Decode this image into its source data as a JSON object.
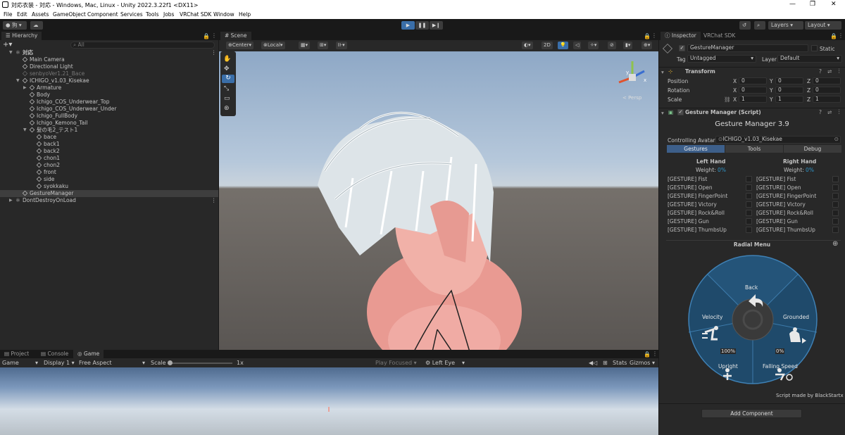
{
  "window": {
    "title": "対応衣装 - 対応 - Windows, Mac, Linux - Unity 2022.3.22f1 <DX11>"
  },
  "menu": [
    "File",
    "Edit",
    "Assets",
    "GameObject",
    "Component",
    "Services",
    "Tools",
    "Jobs",
    "VRChat SDK",
    "Window",
    "Help"
  ],
  "toolbar": {
    "account": "狗",
    "layers": "Layers",
    "layout": "Layout"
  },
  "hierarchy": {
    "tab": "Hierarchy",
    "search_placeholder": "All",
    "items": [
      {
        "label": "対応",
        "depth": 0,
        "kind": "scene"
      },
      {
        "label": "Main Camera",
        "depth": 1,
        "kind": "object"
      },
      {
        "label": "Directional Light",
        "depth": 1,
        "kind": "object"
      },
      {
        "label": "senbyoVer1.21_Bace",
        "depth": 1,
        "kind": "disabled"
      },
      {
        "label": "ICHIGO_v1.03_Kisekae",
        "depth": 1,
        "kind": "object"
      },
      {
        "label": "Armature",
        "depth": 2,
        "kind": "object"
      },
      {
        "label": "Body",
        "depth": 2,
        "kind": "object"
      },
      {
        "label": "Ichigo_COS_Underwear_Top",
        "depth": 2,
        "kind": "object"
      },
      {
        "label": "Ichigo_COS_Underwear_Under",
        "depth": 2,
        "kind": "object"
      },
      {
        "label": "Ichigo_FullBody",
        "depth": 2,
        "kind": "object"
      },
      {
        "label": "Ichigo_Kemono_Tail",
        "depth": 2,
        "kind": "object"
      },
      {
        "label": "髪の毛2_テスト1",
        "depth": 2,
        "kind": "object"
      },
      {
        "label": "bace",
        "depth": 3,
        "kind": "object"
      },
      {
        "label": "back1",
        "depth": 3,
        "kind": "object"
      },
      {
        "label": "back2",
        "depth": 3,
        "kind": "object"
      },
      {
        "label": "chon1",
        "depth": 3,
        "kind": "object"
      },
      {
        "label": "chon2",
        "depth": 3,
        "kind": "object"
      },
      {
        "label": "front",
        "depth": 3,
        "kind": "object"
      },
      {
        "label": "side",
        "depth": 3,
        "kind": "object"
      },
      {
        "label": "syokkaku",
        "depth": 3,
        "kind": "object"
      },
      {
        "label": "GestureManager",
        "depth": 1,
        "kind": "selected"
      },
      {
        "label": "DontDestroyOnLoad",
        "depth": 0,
        "kind": "scene"
      }
    ]
  },
  "scene": {
    "tab": "Scene",
    "pivot": "Center",
    "space": "Local",
    "mode2d": "2D",
    "persp": "< Persp"
  },
  "bottom_tabs": {
    "project": "Project",
    "console": "Console",
    "game": "Game"
  },
  "game": {
    "display_mode": "Game",
    "display": "Display 1",
    "aspect": "Free Aspect",
    "scale_label": "Scale",
    "scale_value": "1x",
    "play_focused": "Play Focused",
    "eye": "Left Eye",
    "stats": "Stats",
    "gizmos": "Gizmos"
  },
  "inspector": {
    "tab": "Inspector",
    "tab2": "VRChat SDK",
    "object_name": "GestureManager",
    "static": "Static",
    "tag_label": "Tag",
    "tag_value": "Untagged",
    "layer_label": "Layer",
    "layer_value": "Default",
    "transform": {
      "title": "Transform",
      "position_label": "Position",
      "rotation_label": "Rotation",
      "scale_label": "Scale",
      "position": [
        "0",
        "0",
        "0"
      ],
      "rotation": [
        "0",
        "0",
        "0"
      ],
      "scale": [
        "1",
        "1",
        "1"
      ],
      "x": "X",
      "y": "Y",
      "z": "Z"
    },
    "script": {
      "title": "Gesture Manager (Script)",
      "heading": "Gesture Manager 3.9",
      "controlling_label": "Controlling Avatar:",
      "controlling_value": "ICHIGO_v1.03_Kisekae",
      "tabs": [
        "Gestures",
        "Tools",
        "Debug"
      ],
      "left_hand": "Left Hand",
      "right_hand": "Right Hand",
      "weight_label": "Weight:",
      "weight_value": "0%",
      "gestures": [
        "[GESTURE] Fist",
        "[GESTURE] Open",
        "[GESTURE] FingerPoint",
        "[GESTURE] Victory",
        "[GESTURE] Rock&Roll",
        "[GESTURE] Gun",
        "[GESTURE] ThumbsUp"
      ],
      "radial_title": "Radial Menu",
      "radial": {
        "back": "Back",
        "grounded": "Grounded",
        "velocity": "Velocity",
        "upright": "Upright",
        "falling": "Falling Speed",
        "upright_value": "100%",
        "falling_value": "0%"
      },
      "credit": "Script made by BlackStartx"
    },
    "add_component": "Add Component"
  }
}
